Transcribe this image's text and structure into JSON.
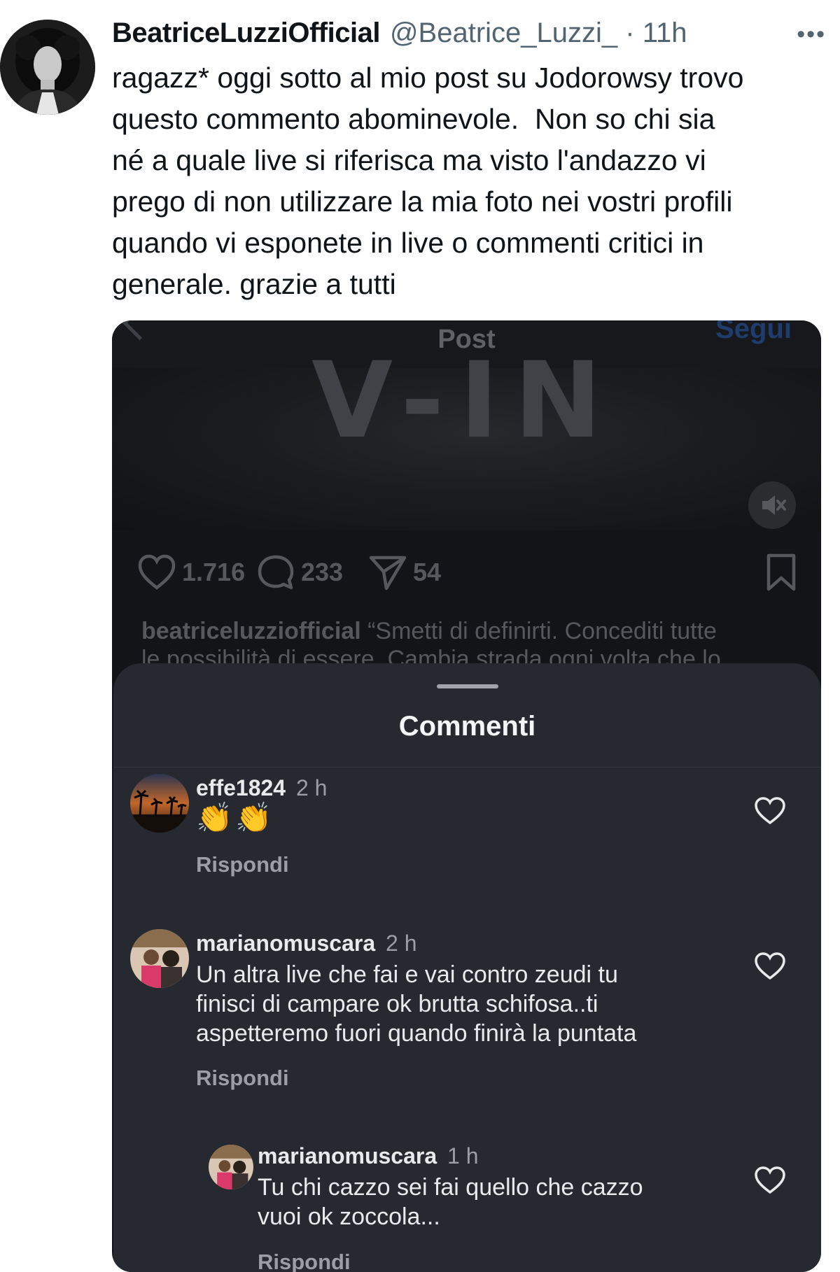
{
  "tweet": {
    "display_name": "BeatriceLuzziOfficial",
    "handle_time": "@Beatrice_Luzzi_ · 11h",
    "more_icon": "more-horizontal-icon",
    "text": "ragazz* oggi sotto al mio post su Jodorowsy trovo\nquesto commento abominevole.  Non so chi sia\nné a quale live si riferisca ma visto l'andazzo vi\nprego di non utilizzare la mia foto nei vostri profili\nquando vi esponete in live o commenti critici in\ngenerale. grazie a tutti"
  },
  "instagram": {
    "top_title": "Post",
    "follow_label": "Segui",
    "photo_text": "V-IN",
    "actions": {
      "likes": "1.716",
      "comments": "233",
      "shares": "54"
    },
    "caption_user": "beatriceluzziofficial",
    "caption_text_line1": " “Smetti di definirti. Concediti tutte",
    "caption_text_line2": "le possibilità di essere. Cambia strada ogni volta che lo",
    "comments_sheet": {
      "title": "Commenti",
      "comments": [
        {
          "user": "effe1824",
          "time": "2 h",
          "text": "👏👏",
          "reply": "Rispondi"
        },
        {
          "user": "marianomuscara",
          "time": "2 h",
          "text": "Un altra live che fai e vai contro zeudi tu\nfinisci di campare ok brutta schifosa..ti\naspetteremo fuori quando finirà la puntata",
          "reply": "Rispondi"
        },
        {
          "user": "marianomuscara",
          "time": "1 h",
          "text": "Tu chi cazzo sei fai quello che cazzo\nvuoi ok zoccola...",
          "reply": "Rispondi"
        }
      ]
    }
  },
  "colors": {
    "twitter_text": "#0f1419",
    "twitter_secondary": "#536471",
    "sheet_bg": "#262a30",
    "instagram_bg": "#121417"
  }
}
